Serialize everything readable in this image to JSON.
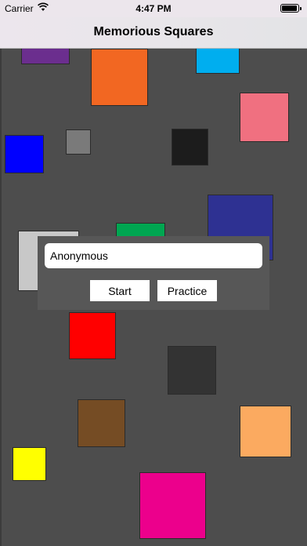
{
  "status": {
    "carrier": "Carrier",
    "time": "4:47 PM",
    "battery_level": 0.95
  },
  "nav": {
    "title": "Memorious Squares"
  },
  "squares": [
    {
      "name": "square-purple",
      "color": "#6b2e8e"
    },
    {
      "name": "square-orange",
      "color": "#f26722"
    },
    {
      "name": "square-light-blue",
      "color": "#00aeef"
    },
    {
      "name": "square-pink",
      "color": "#f07080"
    },
    {
      "name": "square-blue",
      "color": "#0000ff"
    },
    {
      "name": "square-gray",
      "color": "#7a7a7a"
    },
    {
      "name": "square-black",
      "color": "#1c1c1c"
    },
    {
      "name": "square-navy",
      "color": "#2e3192"
    },
    {
      "name": "square-light-gray",
      "color": "#c8c8c8"
    },
    {
      "name": "square-green",
      "color": "#00a651"
    },
    {
      "name": "square-red",
      "color": "#ff0000"
    },
    {
      "name": "square-dark-gray",
      "color": "#333333"
    },
    {
      "name": "square-brown",
      "color": "#754c24"
    },
    {
      "name": "square-peach",
      "color": "#fbaa60"
    },
    {
      "name": "square-yellow",
      "color": "#ffff00"
    },
    {
      "name": "square-magenta",
      "color": "#ec008c"
    }
  ],
  "dialog": {
    "name_value": "Anonymous",
    "start_label": "Start",
    "practice_label": "Practice"
  }
}
